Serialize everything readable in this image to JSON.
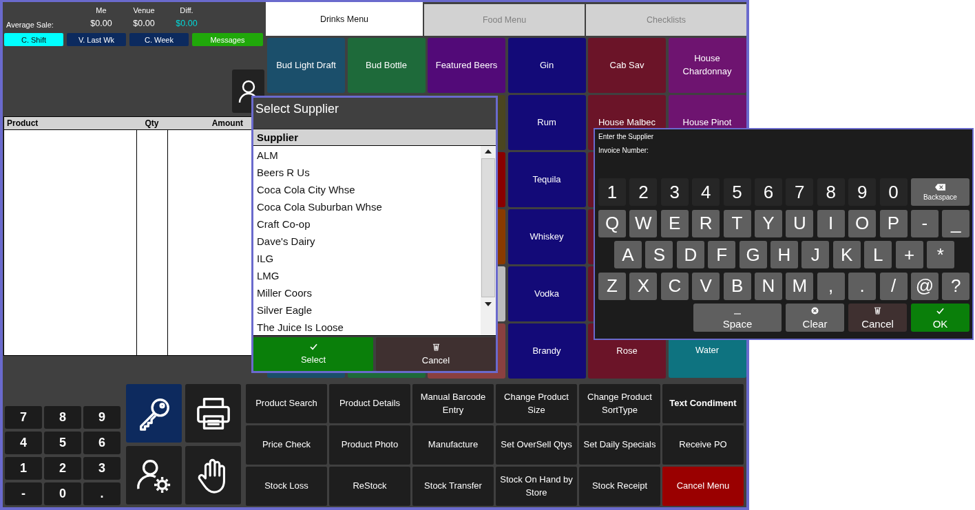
{
  "stats": {
    "headers": [
      "Me",
      "Venue",
      "Diff."
    ],
    "row_label": "Average Sale:",
    "values": [
      {
        "text": "$0.00",
        "kind": "plain"
      },
      {
        "text": "$0.00",
        "kind": "plain"
      },
      {
        "text": "$0.00",
        "kind": "diff"
      }
    ]
  },
  "period_buttons": [
    {
      "label": "C. Shift",
      "color": "#00ffff"
    },
    {
      "label": "V. Last Wk",
      "color": "#0c2a5e"
    },
    {
      "label": "C. Week",
      "color": "#0c2a5e"
    },
    {
      "label": "Messages",
      "color": "#20a80a"
    }
  ],
  "order_table": {
    "columns": [
      "Product",
      "Qty",
      "Amount"
    ]
  },
  "tabs": [
    {
      "label": "Drinks Menu",
      "selected": true
    },
    {
      "label": "Food Menu",
      "selected": false
    },
    {
      "label": "Checklists",
      "selected": false
    }
  ],
  "menu_columns": [
    [
      {
        "label": "Bud Light Draft",
        "color": "#1b4f6b"
      },
      {
        "color": "#1b4f6b"
      }
    ],
    [
      {
        "label": "Bud Bottle",
        "color": "#1e6a3a"
      },
      {
        "color": "#1e6a3a"
      }
    ],
    [
      {
        "label": "Featured Beers",
        "color": "#520a78"
      },
      {
        "color": "#4a4520"
      },
      {
        "color": "#8a0000"
      },
      {
        "color": "#8a3a00"
      },
      {
        "color": "#bdbdbd"
      },
      {
        "color": "#8a4040"
      }
    ],
    [
      {
        "label": "Gin",
        "color": "#130a78"
      },
      {
        "label": "Rum",
        "color": "#130a78"
      },
      {
        "label": "Tequila",
        "color": "#130a78"
      },
      {
        "label": "Whiskey",
        "color": "#130a78"
      },
      {
        "label": "Vodka",
        "color": "#130a78"
      },
      {
        "label": "Brandy",
        "color": "#130a78"
      }
    ],
    [
      {
        "label": "Cab Sav",
        "color": "#6b1428"
      },
      {
        "label": "House Malbec",
        "color": "#6b1428"
      },
      {
        "color": "#6b1428"
      },
      {
        "color": "#6b1428"
      },
      {
        "color": "#6b1428"
      },
      {
        "label": "Rose",
        "color": "#6b1428"
      }
    ],
    [
      {
        "label": "House Chardonnay",
        "color": "#6e1470"
      },
      {
        "label": "House Pinot",
        "color": "#6e1470"
      },
      {
        "label": "Water",
        "color": "#0e7380"
      }
    ]
  ],
  "numpad": [
    "7",
    "8",
    "9",
    "4",
    "5",
    "6",
    "1",
    "2",
    "3",
    "-",
    "0",
    "."
  ],
  "icon_buttons": [
    {
      "kind": "key",
      "selected": true
    },
    {
      "kind": "printer",
      "selected": false
    },
    {
      "kind": "user-settings",
      "selected": false
    },
    {
      "kind": "hand",
      "selected": false
    }
  ],
  "function_buttons": [
    {
      "label": "Product Search",
      "kind": "normal"
    },
    {
      "label": "Product Details",
      "kind": "normal"
    },
    {
      "label": "Manual Barcode Entry",
      "kind": "normal"
    },
    {
      "label": "Change Product Size",
      "kind": "normal"
    },
    {
      "label": "Change Product SortType",
      "kind": "normal"
    },
    {
      "label": "Text Condiment",
      "kind": "bold"
    },
    {
      "label": "Price Check",
      "kind": "normal"
    },
    {
      "label": "Product Photo",
      "kind": "normal"
    },
    {
      "label": "Manufacture",
      "kind": "normal"
    },
    {
      "label": "Set OverSell Qtys",
      "kind": "normal"
    },
    {
      "label": "Set Daily Specials",
      "kind": "normal"
    },
    {
      "label": "Receive PO",
      "kind": "normal"
    },
    {
      "label": "Stock Loss",
      "kind": "normal"
    },
    {
      "label": "ReStock",
      "kind": "normal"
    },
    {
      "label": "Stock Transfer",
      "kind": "normal"
    },
    {
      "label": "Stock On Hand by Store",
      "kind": "normal"
    },
    {
      "label": "Stock Receipt",
      "kind": "normal"
    },
    {
      "label": "Cancel Menu",
      "kind": "danger"
    }
  ],
  "select_supplier": {
    "title": "Select Supplier",
    "column": "Supplier",
    "suppliers": [
      "ALM",
      "Beers R Us",
      "Coca Cola City Whse",
      "Coca Cola Suburban Whse",
      "Craft Co-op",
      "Dave's Dairy",
      "ILG",
      "LMG",
      "Miller Coors",
      "Silver Eagle",
      "The Juice Is Loose"
    ],
    "buttons": [
      {
        "label": "Select",
        "kind": "confirm"
      },
      {
        "label": "Cancel",
        "kind": "cancel"
      }
    ]
  },
  "keyboard": {
    "prompt": "Enter the Supplier",
    "field_label": "Invoice Number:",
    "rows": [
      {
        "kind": "digits",
        "keys": [
          "1",
          "2",
          "3",
          "4",
          "5",
          "6",
          "7",
          "8",
          "9",
          "0"
        ]
      },
      {
        "kind": "letters",
        "keys": [
          "Q",
          "W",
          "E",
          "R",
          "T",
          "Y",
          "U",
          "I",
          "O",
          "P",
          "-",
          "_"
        ]
      },
      {
        "kind": "letters-offset",
        "keys": [
          "A",
          "S",
          "D",
          "F",
          "G",
          "H",
          "J",
          "K",
          "L",
          "+",
          "*"
        ]
      },
      {
        "kind": "letters",
        "keys": [
          "Z",
          "X",
          "C",
          "V",
          "B",
          "N",
          "M",
          ",",
          ".",
          "/",
          "@",
          "?"
        ]
      }
    ],
    "backspace": "Backspace",
    "actions": [
      {
        "label": "Space",
        "kind": "space"
      },
      {
        "label": "Clear",
        "kind": "clear"
      },
      {
        "label": "Cancel",
        "kind": "cancel"
      },
      {
        "label": "OK",
        "kind": "confirm"
      }
    ]
  }
}
